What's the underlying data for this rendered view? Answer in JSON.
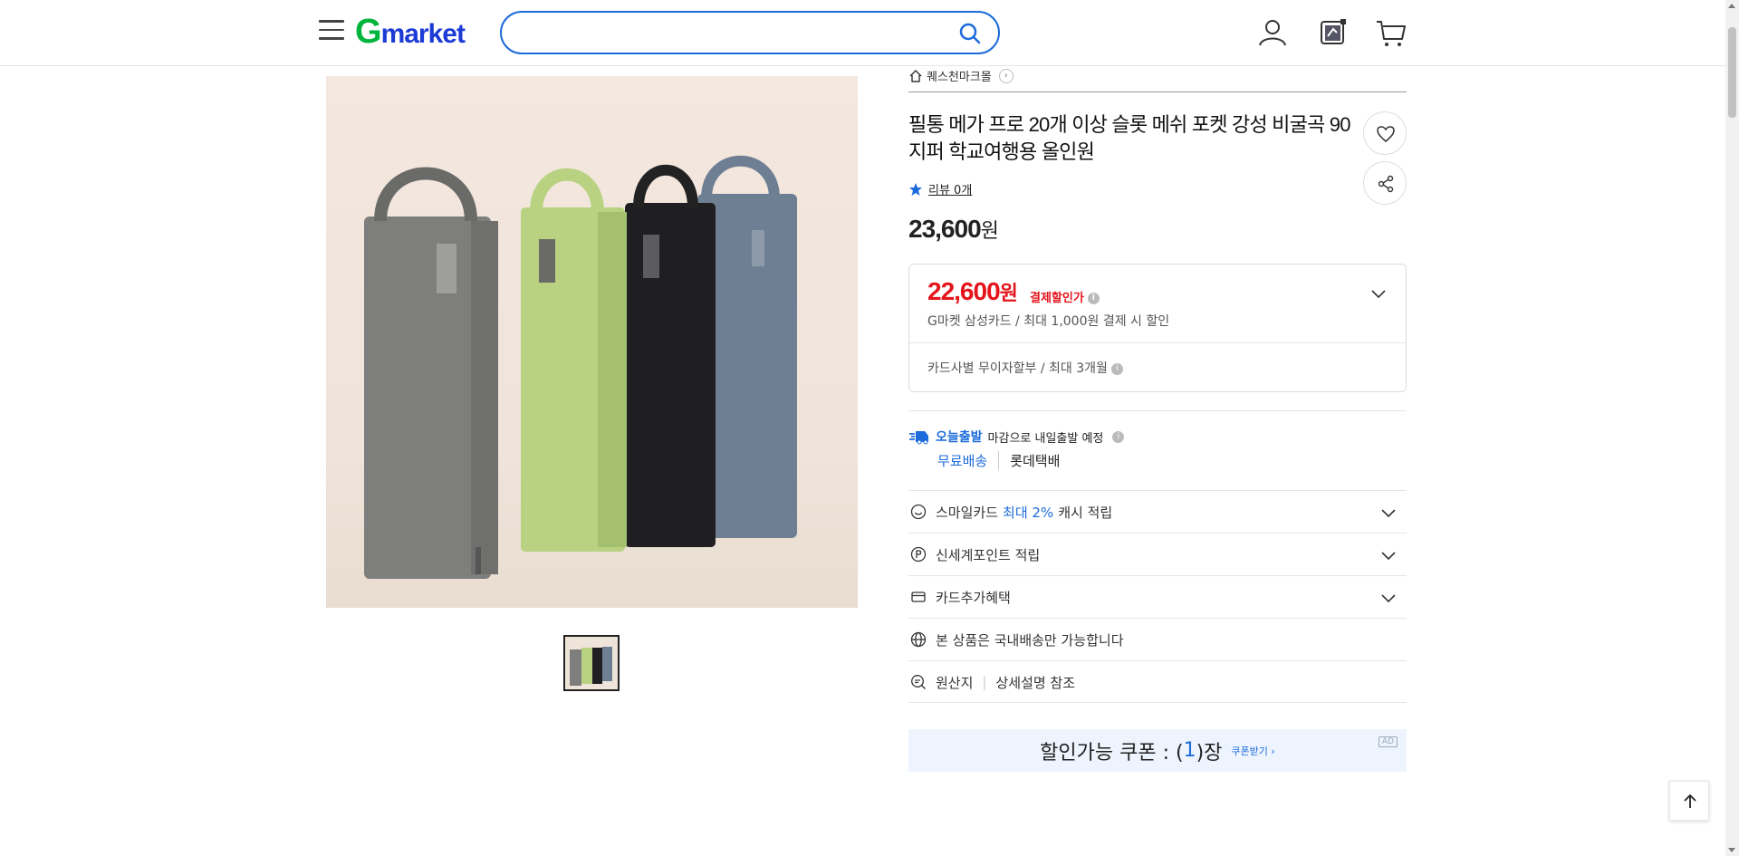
{
  "header": {
    "logo_g": "G",
    "logo_rest": "market",
    "search": {
      "value": "",
      "placeholder": ""
    },
    "icons": [
      "menu-icon",
      "search-icon",
      "user-icon",
      "recent-items-icon",
      "cart-icon"
    ]
  },
  "product": {
    "seller": "퀘스천마크몰",
    "title": "필통 메가 프로 20개 이상 슬롯 메쉬 포켓 강성 비굴곡 90 지퍼 학교여행용 올인원",
    "review_label": "리뷰 0개",
    "price": "23,600",
    "price_unit": "원",
    "discount": {
      "price": "22,600",
      "unit": "원",
      "label": "결제할인가",
      "desc": "G마켓 삼성카드 / 최대 1,000원 결제 시 할인",
      "installment": "카드사별 무이자할부 / 최대 3개월"
    },
    "shipping": {
      "today": "오늘출발",
      "note": "마감으로 내일출발 예정",
      "free": "무료배송",
      "carrier": "롯데택배"
    },
    "benefits": {
      "smile_prefix": "스마일카드",
      "smile_highlight": "최대 2%",
      "smile_suffix": "캐시 적립",
      "shinsegae": "신세계포인트 적립",
      "card": "카드추가혜택",
      "domestic": "본 상품은 국내배송만 가능합니다",
      "origin_label": "원산지",
      "origin_value": "상세설명 참조"
    },
    "coupon": {
      "prefix": "할인가능 쿠폰 : (",
      "count": "1",
      "suffix": ")장",
      "get": "쿠폰받기 ›",
      "ad": "AD"
    }
  },
  "colors": {
    "accent_blue": "#1c6bdb",
    "sale_red": "#e4141b",
    "logo_green": "#00b43c",
    "logo_blue": "#1c3ad6",
    "coupon_bg": "#eef4fd"
  }
}
